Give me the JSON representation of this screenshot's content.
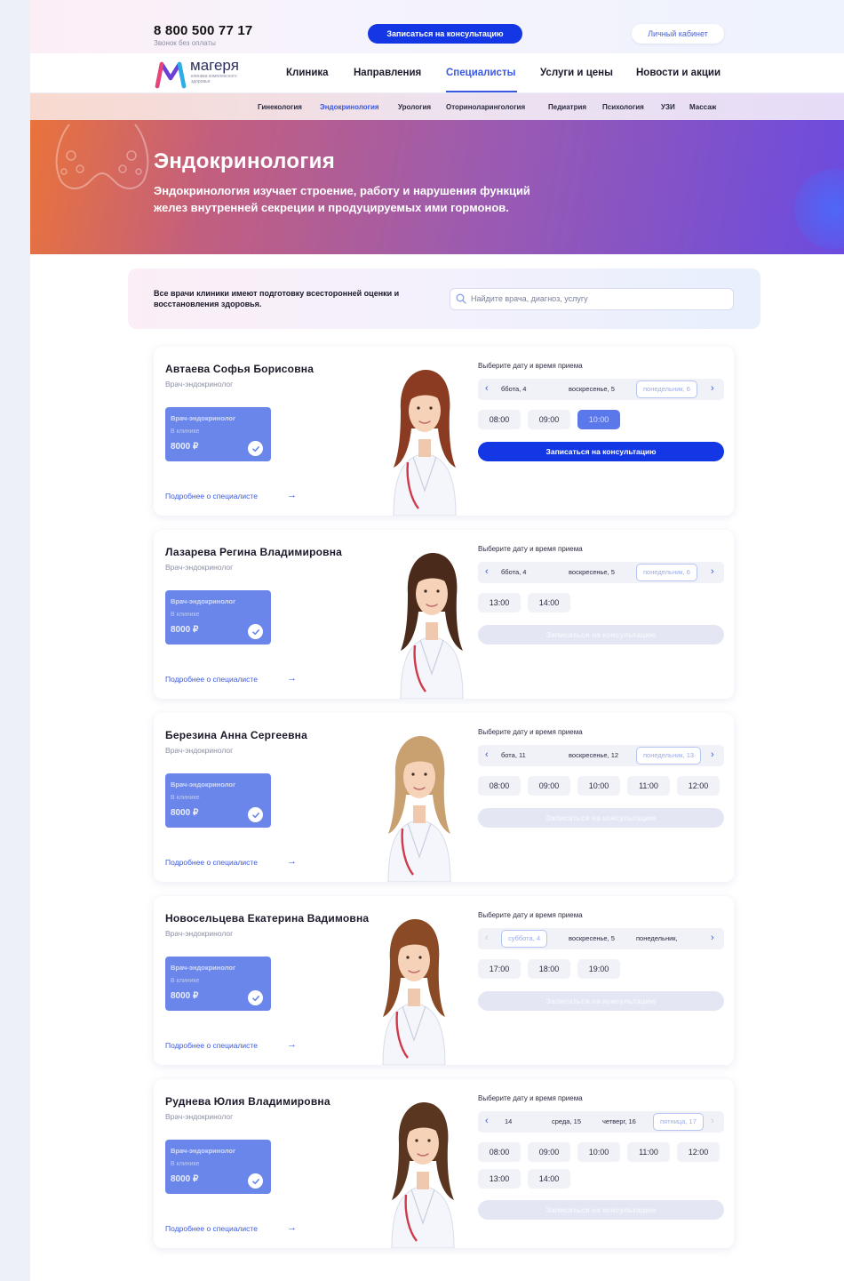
{
  "header": {
    "phone": "8 800 500 77 17",
    "phone_note": "Звонок без оплаты",
    "cta": "Записаться на консультацию",
    "cabinet": "Личный кабинет"
  },
  "logo": {
    "name": "магеря",
    "tagline": "клиника комплексного здоровья"
  },
  "nav": [
    "Клиника",
    "Направления",
    "Специалисты",
    "Услуги и цены",
    "Новости и акции"
  ],
  "nav_active": "Специалисты",
  "subnav": [
    "Гинекология",
    "Эндокринология",
    "Урология",
    "Оториноларингология",
    "Педиатрия",
    "Психология",
    "УЗИ",
    "Массаж"
  ],
  "subnav_active": "Эндокринология",
  "hero": {
    "title": "Эндокринология",
    "text": "Эндокринология изучает строение, работу и нарушения функций желез внутренней секреции и продуцируемых ими гормонов."
  },
  "info": {
    "text": "Все врачи клиники имеют подготовку всесторонней оценки и восстановления здоровья.",
    "search_placeholder": "Найдите врача, диагноз, услугу"
  },
  "labels": {
    "schedule_title": "Выберите дату и время приема",
    "book": "Записаться на консультацию",
    "more": "Подробнее о специалисте",
    "price_place": "В клинике"
  },
  "colors": {
    "accent": "#1437e6",
    "price_box": "#6a86ea",
    "link": "#3a58e0"
  },
  "doctors": [
    {
      "name": "Автаева Софья Борисовна",
      "role": "Врач-эндокринолог",
      "price": "8000 ₽",
      "dates": [
        "ббота, 4",
        "воскресенье, 5",
        "понедельник, 6"
      ],
      "selected_date": 2,
      "slots": [
        "08:00",
        "09:00",
        "10:00"
      ],
      "selected_slot": 2,
      "book_active": true,
      "hair": "#8a3b22"
    },
    {
      "name": "Лазарева Регина Владимировна",
      "role": "Врач-эндокринолог",
      "price": "8000 ₽",
      "dates": [
        "ббота, 4",
        "воскресенье, 5",
        "понедельник, 6"
      ],
      "selected_date": 2,
      "slots": [
        "13:00",
        "14:00"
      ],
      "selected_slot": -1,
      "book_active": false,
      "hair": "#4a2a1a"
    },
    {
      "name": "Березина Анна Сергеевна",
      "role": "Врач-эндокринолог",
      "price": "8000 ₽",
      "dates": [
        "бота, 11",
        "воскресенье, 12",
        "понедельник, 13"
      ],
      "selected_date": 2,
      "slots": [
        "08:00",
        "09:00",
        "10:00",
        "11:00",
        "12:00"
      ],
      "selected_slot": -1,
      "book_active": false,
      "hair": "#c9a070"
    },
    {
      "name": "Новосельцева Екатерина Вадимовна",
      "role": "Врач-эндокринолог",
      "price": "8000 ₽",
      "dates": [
        "суббота, 4",
        "воскресенье, 5",
        "понедельник,"
      ],
      "selected_date": 0,
      "slots": [
        "17:00",
        "18:00",
        "19:00"
      ],
      "selected_slot": -1,
      "book_active": false,
      "hair": "#8a4a25"
    },
    {
      "name": "Руднева Юлия Владимировна",
      "role": "Врач-эндокринолог",
      "price": "8000 ₽",
      "dates": [
        "14",
        "среда, 15",
        "четверг, 16",
        "пятница, 17"
      ],
      "selected_date": 3,
      "slots": [
        "08:00",
        "09:00",
        "10:00",
        "11:00",
        "12:00",
        "13:00",
        "14:00"
      ],
      "selected_slot": -1,
      "book_active": false,
      "hair": "#5a3520"
    }
  ]
}
